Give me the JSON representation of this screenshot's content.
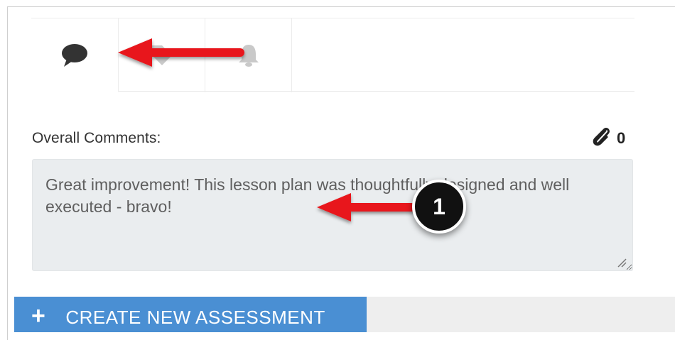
{
  "tabs": [
    {
      "icon": "speech-bubble-icon",
      "active": true
    },
    {
      "icon": "tag-icon",
      "active": false
    },
    {
      "icon": "bell-icon",
      "active": false
    }
  ],
  "comments": {
    "label": "Overall Comments:",
    "attachment_count": "0",
    "text": "Great improvement! This lesson plan was thoughtfully designed and well executed - bravo!"
  },
  "actions": {
    "create_label": "CREATE NEW ASSESSMENT"
  },
  "annotation": {
    "step_number": "1",
    "arrow_color": "#e8191a"
  },
  "colors": {
    "button_blue": "#4a8fd3",
    "textarea_bg": "#eaedef",
    "icon_gray": "#333333",
    "icon_light": "#c9c9c9"
  }
}
